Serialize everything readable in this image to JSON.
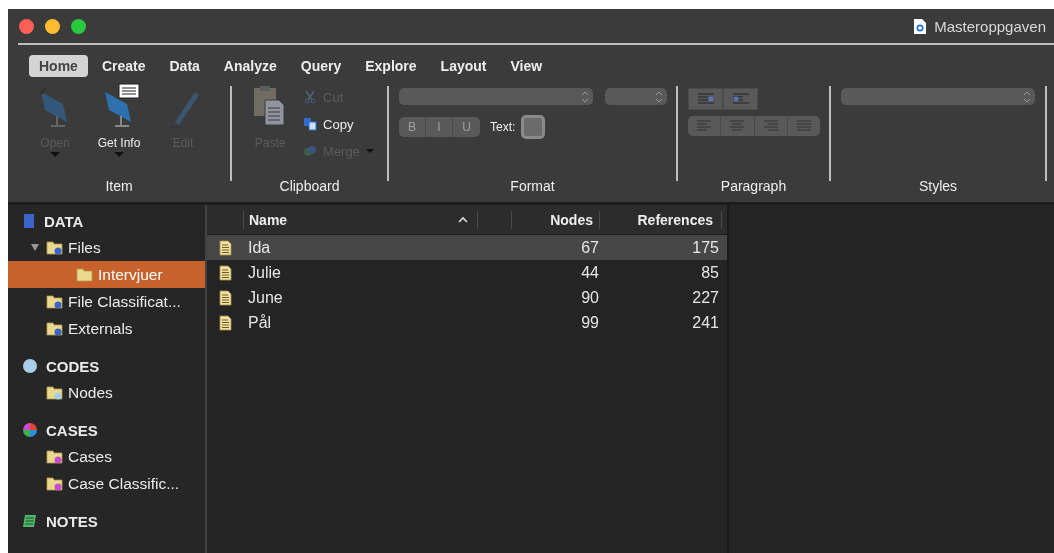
{
  "window": {
    "title": "Masteroppgaven"
  },
  "tabs": [
    {
      "label": "Home",
      "selected": true
    },
    {
      "label": "Create",
      "selected": false
    },
    {
      "label": "Data",
      "selected": false
    },
    {
      "label": "Analyze",
      "selected": false
    },
    {
      "label": "Query",
      "selected": false
    },
    {
      "label": "Explore",
      "selected": false
    },
    {
      "label": "Layout",
      "selected": false
    },
    {
      "label": "View",
      "selected": false
    }
  ],
  "ribbon": {
    "item": {
      "label": "Item",
      "buttons": [
        {
          "kind": "open",
          "label": "Open",
          "disabled": true
        },
        {
          "kind": "info",
          "label": "Get Info",
          "disabled": false
        },
        {
          "kind": "edit",
          "label": "Edit",
          "disabled": true
        }
      ]
    },
    "clipboard": {
      "label": "Clipboard",
      "paste": {
        "label": "Paste",
        "disabled": true
      },
      "actions": [
        {
          "kind": "cut",
          "label": "Cut",
          "disabled": true
        },
        {
          "kind": "copy",
          "label": "Copy",
          "disabled": false
        },
        {
          "kind": "merge",
          "label": "Merge",
          "disabled": true
        }
      ]
    },
    "format": {
      "label": "Format",
      "styles": [
        {
          "label": "B",
          "disabled": true
        },
        {
          "label": "I",
          "disabled": true
        },
        {
          "label": "U",
          "disabled": true
        }
      ],
      "text_label": "Text:"
    },
    "paragraph": {
      "label": "Paragraph"
    },
    "styles": {
      "label": "Styles"
    }
  },
  "sidebar": [
    {
      "title": "DATA",
      "kind": "data",
      "items": [
        {
          "label": "Files",
          "selected": false,
          "expanded": true,
          "children": [
            {
              "label": "Intervjuer",
              "selected": true
            }
          ]
        },
        {
          "label": "File Classificat...",
          "selected": false
        },
        {
          "label": "Externals",
          "selected": false
        }
      ]
    },
    {
      "title": "CODES",
      "kind": "codes",
      "items": [
        {
          "label": "Nodes",
          "selected": false
        }
      ]
    },
    {
      "title": "CASES",
      "kind": "cases",
      "items": [
        {
          "label": "Cases",
          "selected": false
        },
        {
          "label": "Case Classific...",
          "selected": false
        }
      ]
    },
    {
      "title": "NOTES",
      "kind": "notes"
    }
  ],
  "table": {
    "columns": [
      "Name",
      "Nodes",
      "References"
    ],
    "rows": [
      {
        "name": "Ida",
        "nodes": "67",
        "references": "175",
        "selected": true
      },
      {
        "name": "Julie",
        "nodes": "44",
        "references": "85",
        "selected": false
      },
      {
        "name": "June",
        "nodes": "90",
        "references": "227",
        "selected": false
      },
      {
        "name": "Pål",
        "nodes": "99",
        "references": "241",
        "selected": false
      }
    ]
  }
}
